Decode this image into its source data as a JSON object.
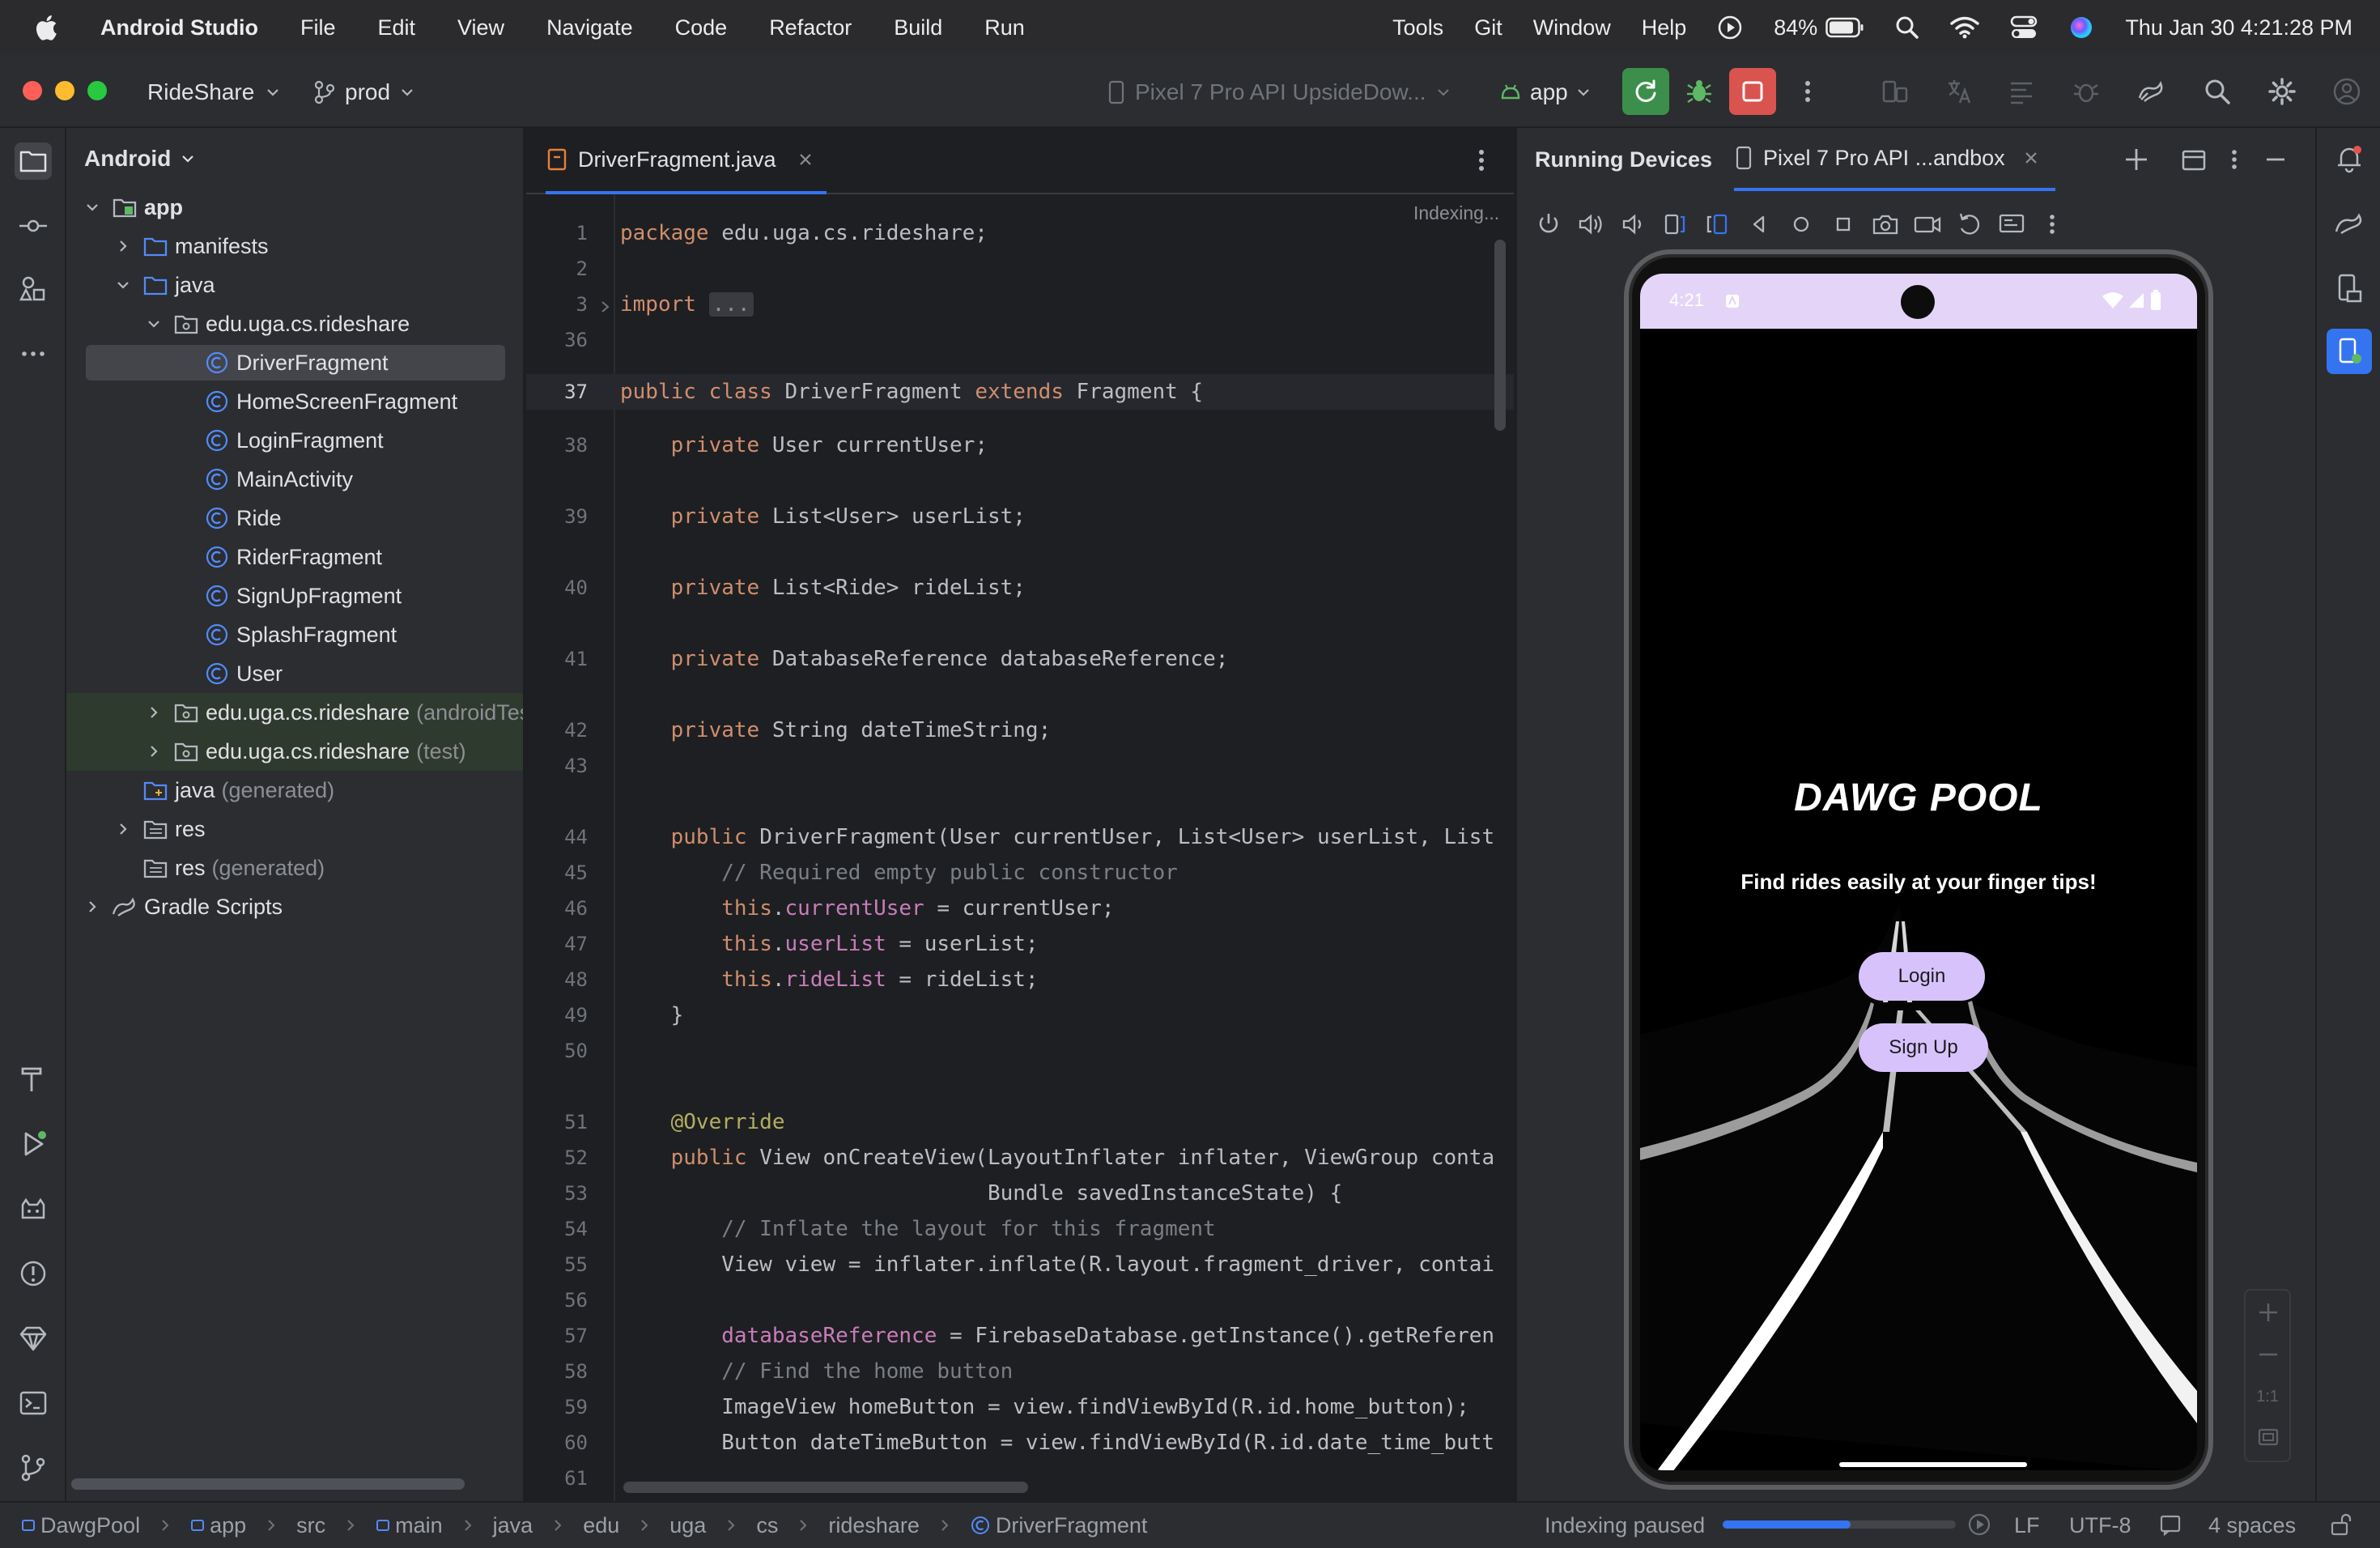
{
  "menubar": {
    "app_name": "Android Studio",
    "items": [
      "File",
      "Edit",
      "View",
      "Navigate",
      "Code",
      "Refactor",
      "Build",
      "Run"
    ],
    "right_items": [
      "Tools",
      "Git",
      "Window",
      "Help"
    ],
    "battery": "84%",
    "datetime": "Thu Jan 30  4:21:28 PM"
  },
  "toolbar": {
    "project": "RideShare",
    "branch": "prod",
    "device": "Pixel 7 Pro API UpsideDow...",
    "run_config": "app"
  },
  "project_panel": {
    "title": "Android",
    "tree": [
      {
        "label": "app",
        "level": 0,
        "icon": "module",
        "expanded": true,
        "bold": true
      },
      {
        "label": "manifests",
        "level": 1,
        "icon": "folder",
        "expanded": false
      },
      {
        "label": "java",
        "level": 1,
        "icon": "folder",
        "expanded": true
      },
      {
        "label": "edu.uga.cs.rideshare",
        "level": 2,
        "icon": "package",
        "expanded": true
      },
      {
        "label": "DriverFragment",
        "level": 3,
        "icon": "class",
        "selected": true
      },
      {
        "label": "HomeScreenFragment",
        "level": 3,
        "icon": "class"
      },
      {
        "label": "LoginFragment",
        "level": 3,
        "icon": "class"
      },
      {
        "label": "MainActivity",
        "level": 3,
        "icon": "class"
      },
      {
        "label": "Ride",
        "level": 3,
        "icon": "class"
      },
      {
        "label": "RiderFragment",
        "level": 3,
        "icon": "class"
      },
      {
        "label": "SignUpFragment",
        "level": 3,
        "icon": "class"
      },
      {
        "label": "SplashFragment",
        "level": 3,
        "icon": "class"
      },
      {
        "label": "User",
        "level": 3,
        "icon": "class"
      },
      {
        "label": "edu.uga.cs.rideshare",
        "suffix": "(androidTest)",
        "level": 2,
        "icon": "package",
        "expanded": false,
        "tinted": true
      },
      {
        "label": "edu.uga.cs.rideshare",
        "suffix": "(test)",
        "level": 2,
        "icon": "package",
        "expanded": false,
        "tinted": true
      },
      {
        "label": "java",
        "suffix": "(generated)",
        "level": 1,
        "icon": "folder-gen"
      },
      {
        "label": "res",
        "level": 1,
        "icon": "folder-res",
        "expanded": false
      },
      {
        "label": "res",
        "suffix": "(generated)",
        "level": 1,
        "icon": "folder-res"
      },
      {
        "label": "Gradle Scripts",
        "level": 0,
        "icon": "gradle",
        "expanded": false
      }
    ]
  },
  "editor": {
    "tab": "DriverFragment.java",
    "indexing": "Indexing...",
    "lines": [
      {
        "n": "1",
        "code": [
          [
            "kw",
            "package "
          ],
          [
            "t",
            "edu.uga.cs.rideshare;"
          ]
        ]
      },
      {
        "n": "2",
        "code": []
      },
      {
        "n": "3",
        "code": [
          [
            "kw",
            "import "
          ],
          [
            "fold",
            "..."
          ]
        ]
      },
      {
        "n": "36",
        "code": []
      },
      {
        "n": "37",
        "code": [
          [
            "kw",
            "public class "
          ],
          [
            "t",
            "DriverFragment "
          ],
          [
            "kw",
            "extends "
          ],
          [
            "t",
            "Fragment {"
          ]
        ]
      },
      {
        "n": "38",
        "code": [
          [
            "t",
            "    "
          ],
          [
            "kw",
            "private "
          ],
          [
            "t",
            "User currentUser;"
          ]
        ]
      },
      {
        "n": "39",
        "code": [
          [
            "t",
            "    "
          ],
          [
            "kw",
            "private "
          ],
          [
            "t",
            "List<User> userList;"
          ]
        ]
      },
      {
        "n": "40",
        "code": [
          [
            "t",
            "    "
          ],
          [
            "kw",
            "private "
          ],
          [
            "t",
            "List<Ride> rideList;"
          ]
        ]
      },
      {
        "n": "41",
        "code": [
          [
            "t",
            "    "
          ],
          [
            "kw",
            "private "
          ],
          [
            "t",
            "DatabaseReference databaseReference;"
          ]
        ]
      },
      {
        "n": "42",
        "code": [
          [
            "t",
            "    "
          ],
          [
            "kw",
            "private "
          ],
          [
            "t",
            "String dateTimeString;"
          ]
        ]
      },
      {
        "n": "43",
        "code": []
      },
      {
        "n": "44",
        "code": [
          [
            "t",
            "    "
          ],
          [
            "kw",
            "public "
          ],
          [
            "t",
            "DriverFragment(User currentUser, List<User> userList, List"
          ]
        ]
      },
      {
        "n": "45",
        "code": [
          [
            "cm",
            "        // Required empty public constructor"
          ]
        ]
      },
      {
        "n": "46",
        "code": [
          [
            "t",
            "        "
          ],
          [
            "kw",
            "this"
          ],
          [
            "t",
            "."
          ],
          [
            "fd",
            "currentUser"
          ],
          [
            "t",
            " = currentUser;"
          ]
        ]
      },
      {
        "n": "47",
        "code": [
          [
            "t",
            "        "
          ],
          [
            "kw",
            "this"
          ],
          [
            "t",
            "."
          ],
          [
            "fd",
            "userList"
          ],
          [
            "t",
            " = userList;"
          ]
        ]
      },
      {
        "n": "48",
        "code": [
          [
            "t",
            "        "
          ],
          [
            "kw",
            "this"
          ],
          [
            "t",
            "."
          ],
          [
            "fd",
            "rideList"
          ],
          [
            "t",
            " = rideList;"
          ]
        ]
      },
      {
        "n": "49",
        "code": [
          [
            "t",
            "    }"
          ]
        ]
      },
      {
        "n": "50",
        "code": []
      },
      {
        "n": "51",
        "code": [
          [
            "an",
            "    @Override"
          ]
        ]
      },
      {
        "n": "52",
        "code": [
          [
            "t",
            "    "
          ],
          [
            "kw",
            "public "
          ],
          [
            "t",
            "View onCreateView(LayoutInflater inflater, ViewGroup conta"
          ]
        ]
      },
      {
        "n": "53",
        "code": [
          [
            "t",
            "                             Bundle savedInstanceState) {"
          ]
        ]
      },
      {
        "n": "54",
        "code": [
          [
            "cm",
            "        // Inflate the layout for this fragment"
          ]
        ]
      },
      {
        "n": "55",
        "code": [
          [
            "t",
            "        View view = inflater.inflate(R.layout.fragment_driver, contai"
          ]
        ]
      },
      {
        "n": "56",
        "code": []
      },
      {
        "n": "57",
        "code": [
          [
            "t",
            "        "
          ],
          [
            "fd",
            "databaseReference"
          ],
          [
            "t",
            " = FirebaseDatabase.getInstance().getReferen"
          ]
        ]
      },
      {
        "n": "58",
        "code": [
          [
            "cm",
            "        // Find the home button"
          ]
        ]
      },
      {
        "n": "59",
        "code": [
          [
            "t",
            "        ImageView homeButton = view.findViewById(R.id.home_button);"
          ]
        ]
      },
      {
        "n": "60",
        "code": [
          [
            "t",
            "        Button dateTimeButton = view.findViewById(R.id.date_time_butt"
          ]
        ]
      },
      {
        "n": "61",
        "code": []
      }
    ]
  },
  "devices": {
    "title": "Running Devices",
    "tab": "Pixel 7 Pro API ...andbox",
    "phone": {
      "time": "4:21",
      "app_title": "DAWG POOL",
      "tagline": "Find rides easily at your finger tips!",
      "login": "Login",
      "signup": "Sign Up"
    },
    "zoom_reset": "1:1"
  },
  "statusbar": {
    "breadcrumbs": [
      "DawgPool",
      "app",
      "src",
      "main",
      "java",
      "edu",
      "uga",
      "cs",
      "rideshare",
      "DriverFragment"
    ],
    "indexing": "Indexing paused",
    "progress": 0.55,
    "line_sep": "LF",
    "encoding": "UTF-8",
    "indent": "4 spaces"
  },
  "colors": {
    "accent": "#3574f0",
    "run_green": "#4caf50",
    "stop_red": "#e5534b",
    "phone_button": "#d8c2fc"
  }
}
